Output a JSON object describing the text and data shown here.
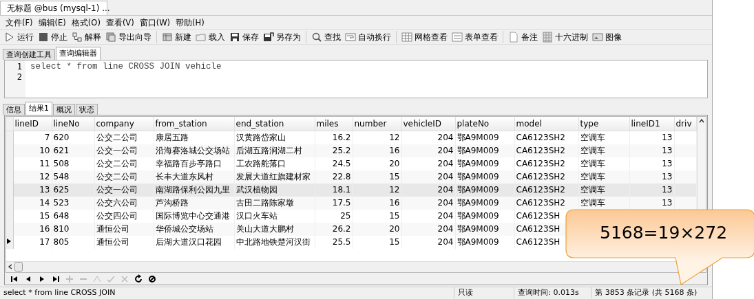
{
  "window": {
    "title": "无标题 @bus (mysql-1) ..."
  },
  "menu": [
    "文件(F)",
    "编辑(E)",
    "格式(O)",
    "查看(V)",
    "窗口(W)",
    "帮助(H)"
  ],
  "toolbar": [
    [
      {
        "kind": "run",
        "label": "运行"
      },
      {
        "kind": "stop",
        "label": "停止"
      },
      {
        "kind": "explain",
        "label": "解释"
      },
      {
        "kind": "export",
        "label": "导出向导"
      }
    ],
    [
      {
        "kind": "new",
        "label": "新建"
      },
      {
        "kind": "load",
        "label": "载入"
      },
      {
        "kind": "save",
        "label": "保存"
      },
      {
        "kind": "saveas",
        "label": "另存为"
      }
    ],
    [
      {
        "kind": "find",
        "label": "查找"
      },
      {
        "kind": "wrap",
        "label": "自动换行"
      }
    ],
    [
      {
        "kind": "grid",
        "label": "网格查看"
      },
      {
        "kind": "form",
        "label": "表单查看"
      }
    ],
    [
      {
        "kind": "note",
        "label": "备注"
      },
      {
        "kind": "hex",
        "label": "十六进制"
      },
      {
        "kind": "image",
        "label": "图像"
      }
    ]
  ],
  "editor_tabs": [
    {
      "label": "查询创建工具",
      "selected": false
    },
    {
      "label": "查询编辑器",
      "selected": true
    }
  ],
  "editor": {
    "line_numbers": [
      "1",
      "2"
    ],
    "code": [
      "select * from line CROSS JOIN vehicle"
    ]
  },
  "result_tabs": [
    {
      "label": "信息",
      "selected": false
    },
    {
      "label": "结果1",
      "selected": true
    },
    {
      "label": "概况",
      "selected": false
    },
    {
      "label": "状态",
      "selected": false
    }
  ],
  "table": {
    "columns": [
      "lineID",
      "lineNo",
      "company",
      "from_station",
      "end_station",
      "miles",
      "number",
      "vehicleID",
      "plateNo",
      "model",
      "type",
      "lineID1",
      "driv"
    ],
    "rows": [
      {
        "current": false,
        "highlighted": false,
        "cells": [
          "7",
          "620",
          "公交二公司",
          "康居五路",
          "汉黄路岱家山",
          "16.2",
          "12",
          "204",
          "鄂A9M009",
          "CA6123SH2",
          "空调车",
          "13"
        ]
      },
      {
        "current": false,
        "highlighted": false,
        "cells": [
          "10",
          "621",
          "公交一公司",
          "沿海赛洛城公交场站",
          "后湖五路涧湖二村",
          "25.2",
          "16",
          "204",
          "鄂A9M009",
          "CA6123SH2",
          "空调车",
          "13"
        ]
      },
      {
        "current": false,
        "highlighted": false,
        "cells": [
          "11",
          "508",
          "公交二公司",
          "幸福路百步亭路口",
          "工农路舵落口",
          "24.5",
          "20",
          "204",
          "鄂A9M009",
          "CA6123SH2",
          "空调车",
          "13"
        ]
      },
      {
        "current": false,
        "highlighted": false,
        "cells": [
          "12",
          "548",
          "公交二公司",
          "长丰大道东风村",
          "发展大道红旗建材家",
          "22.8",
          "15",
          "204",
          "鄂A9M009",
          "CA6123SH2",
          "空调车",
          "13"
        ]
      },
      {
        "current": false,
        "highlighted": true,
        "cells": [
          "13",
          "625",
          "公交一公司",
          "南湖路保利公园九里",
          "武汉植物园",
          "18.1",
          "12",
          "204",
          "鄂A9M009",
          "CA6123SH2",
          "空调车",
          "13"
        ]
      },
      {
        "current": false,
        "highlighted": false,
        "cells": [
          "14",
          "523",
          "公交六公司",
          "芦沟桥路",
          "古田二路陈家墩",
          "17.5",
          "16",
          "204",
          "鄂A9M009",
          "CA6123SH2",
          "空调车",
          "13"
        ]
      },
      {
        "current": false,
        "highlighted": false,
        "cells": [
          "15",
          "648",
          "公交四公司",
          "国际博览中心交通港",
          "汉口火车站",
          "25",
          "15",
          "204",
          "鄂A9M009",
          "CA6123SH"
        ]
      },
      {
        "current": false,
        "highlighted": false,
        "cells": [
          "16",
          "810",
          "通恒公司",
          "华侨城公交场站",
          "关山大道大鹏村",
          "26.2",
          "20",
          "204",
          "鄂A9M009",
          "CA6123SH"
        ]
      },
      {
        "current": true,
        "highlighted": false,
        "cells": [
          "17",
          "805",
          "通恒公司",
          "后湖大道汉口花园",
          "中北路地铁楚河汉街",
          "25.5",
          "15",
          "204",
          "鄂A9M009",
          "CA6123SH"
        ]
      }
    ]
  },
  "navigator": [
    {
      "kind": "first",
      "disabled": false
    },
    {
      "kind": "prev",
      "disabled": false
    },
    {
      "kind": "next",
      "disabled": false
    },
    {
      "kind": "last",
      "disabled": false
    },
    {
      "kind": "add",
      "disabled": true
    },
    {
      "kind": "delete",
      "disabled": true
    },
    {
      "kind": "edit",
      "disabled": true
    },
    {
      "kind": "apply",
      "disabled": true
    },
    {
      "kind": "cancel",
      "disabled": true
    },
    {
      "kind": "refresh",
      "disabled": false
    },
    {
      "kind": "stop",
      "disabled": false
    }
  ],
  "status_bar": {
    "query": "select * from line CROSS JOIN",
    "mode": "只读",
    "time": "查询时间: 0.013s",
    "record": "第 3853 条记录 (共 5168 条)"
  },
  "callout": {
    "text": "5168=19×272"
  }
}
